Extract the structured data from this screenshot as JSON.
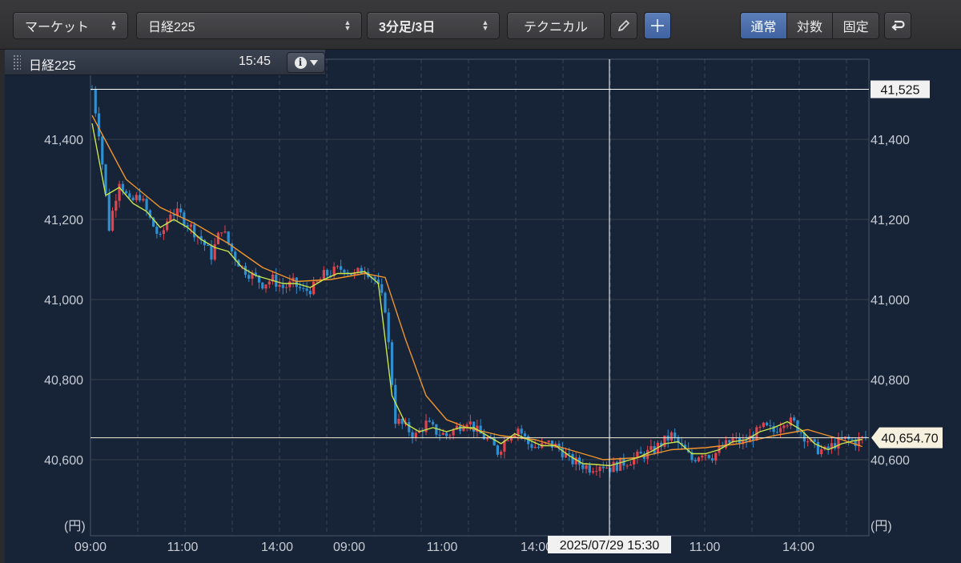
{
  "toolbar": {
    "market_select": "マーケット",
    "symbol_select": "日経225",
    "interval_select": "3分足/3日",
    "technical_button": "テクニカル",
    "scale_modes": [
      "通常",
      "対数",
      "固定"
    ],
    "active_scale_mode": "通常"
  },
  "chart_header": {
    "symbol": "日経225",
    "time": "15:45"
  },
  "colors": {
    "background": "#172336",
    "up_candle": "#e0454d",
    "down_candle": "#2f8fd0",
    "ma_short": "#c8e64a",
    "ma_long": "#f0942c",
    "accent": "#4a6fae"
  },
  "chart_data": {
    "type": "candlestick",
    "symbol": "日経225",
    "unit_label": "(円)",
    "y_range": [
      40410,
      41600
    ],
    "y_ticks": [
      "41,400",
      "41,200",
      "41,000",
      "40,800",
      "40,600"
    ],
    "x_ticks": [
      "09:00",
      "11:00",
      "14:00",
      "09:00",
      "11:00",
      "14:00",
      "11:00",
      "14:00"
    ],
    "grid": true,
    "high_line": {
      "value": 41525,
      "label": "41,525"
    },
    "last_price": {
      "value": 40654.7,
      "label": "40,654.70"
    },
    "crosshair_label": "2025/07/29 15:30",
    "price_path": [
      [
        0,
        41525
      ],
      [
        2,
        41420
      ],
      [
        5,
        41180
      ],
      [
        8,
        41300
      ],
      [
        11,
        41240
      ],
      [
        14,
        41260
      ],
      [
        17,
        41200
      ],
      [
        20,
        41150
      ],
      [
        23,
        41220
      ],
      [
        26,
        41210
      ],
      [
        29,
        41180
      ],
      [
        32,
        41150
      ],
      [
        35,
        41110
      ],
      [
        38,
        41180
      ],
      [
        41,
        41120
      ],
      [
        44,
        41080
      ],
      [
        47,
        41060
      ],
      [
        50,
        41040
      ],
      [
        53,
        41050
      ],
      [
        56,
        41030
      ],
      [
        59,
        41040
      ],
      [
        62,
        41020
      ],
      [
        65,
        41030
      ],
      [
        68,
        41060
      ],
      [
        71,
        41070
      ],
      [
        74,
        41080
      ],
      [
        77,
        41060
      ],
      [
        80,
        41080
      ],
      [
        83,
        41050
      ],
      [
        86,
        40980
      ],
      [
        89,
        40700
      ],
      [
        92,
        40680
      ],
      [
        95,
        40660
      ],
      [
        98,
        40690
      ],
      [
        101,
        40670
      ],
      [
        104,
        40660
      ],
      [
        107,
        40680
      ],
      [
        110,
        40700
      ],
      [
        113,
        40670
      ],
      [
        116,
        40650
      ],
      [
        119,
        40620
      ],
      [
        122,
        40660
      ],
      [
        125,
        40680
      ],
      [
        128,
        40640
      ],
      [
        131,
        40630
      ],
      [
        134,
        40640
      ],
      [
        137,
        40630
      ],
      [
        140,
        40600
      ],
      [
        143,
        40590
      ],
      [
        146,
        40580
      ],
      [
        149,
        40590
      ],
      [
        152,
        40580
      ],
      [
        155,
        40590
      ],
      [
        158,
        40600
      ],
      [
        161,
        40610
      ],
      [
        164,
        40620
      ],
      [
        167,
        40640
      ],
      [
        170,
        40660
      ],
      [
        173,
        40630
      ],
      [
        176,
        40600
      ],
      [
        179,
        40620
      ],
      [
        182,
        40610
      ],
      [
        185,
        40630
      ],
      [
        188,
        40650
      ],
      [
        191,
        40640
      ],
      [
        194,
        40660
      ],
      [
        197,
        40680
      ],
      [
        200,
        40670
      ],
      [
        203,
        40700
      ],
      [
        206,
        40690
      ],
      [
        209,
        40660
      ],
      [
        212,
        40630
      ],
      [
        215,
        40620
      ],
      [
        218,
        40640
      ],
      [
        221,
        40650
      ],
      [
        224,
        40645
      ],
      [
        227,
        40655
      ]
    ],
    "ma_short_path": [
      [
        0,
        41440
      ],
      [
        4,
        41260
      ],
      [
        8,
        41280
      ],
      [
        12,
        41240
      ],
      [
        16,
        41220
      ],
      [
        20,
        41180
      ],
      [
        24,
        41200
      ],
      [
        28,
        41180
      ],
      [
        32,
        41150
      ],
      [
        36,
        41130
      ],
      [
        40,
        41120
      ],
      [
        44,
        41080
      ],
      [
        48,
        41060
      ],
      [
        52,
        41050
      ],
      [
        56,
        41040
      ],
      [
        60,
        41040
      ],
      [
        64,
        41030
      ],
      [
        68,
        41050
      ],
      [
        72,
        41065
      ],
      [
        76,
        41065
      ],
      [
        80,
        41070
      ],
      [
        84,
        41040
      ],
      [
        88,
        40760
      ],
      [
        92,
        40690
      ],
      [
        96,
        40670
      ],
      [
        100,
        40680
      ],
      [
        104,
        40670
      ],
      [
        108,
        40680
      ],
      [
        112,
        40680
      ],
      [
        116,
        40660
      ],
      [
        120,
        40640
      ],
      [
        124,
        40665
      ],
      [
        128,
        40650
      ],
      [
        132,
        40635
      ],
      [
        136,
        40635
      ],
      [
        140,
        40610
      ],
      [
        144,
        40590
      ],
      [
        148,
        40588
      ],
      [
        152,
        40585
      ],
      [
        156,
        40595
      ],
      [
        160,
        40605
      ],
      [
        164,
        40620
      ],
      [
        168,
        40640
      ],
      [
        172,
        40645
      ],
      [
        176,
        40615
      ],
      [
        180,
        40615
      ],
      [
        184,
        40625
      ],
      [
        188,
        40645
      ],
      [
        192,
        40650
      ],
      [
        196,
        40670
      ],
      [
        200,
        40680
      ],
      [
        204,
        40695
      ],
      [
        208,
        40675
      ],
      [
        212,
        40640
      ],
      [
        216,
        40625
      ],
      [
        220,
        40640
      ],
      [
        224,
        40648
      ],
      [
        227,
        40652
      ]
    ],
    "ma_long_path": [
      [
        0,
        41460
      ],
      [
        10,
        41300
      ],
      [
        20,
        41230
      ],
      [
        30,
        41190
      ],
      [
        40,
        41140
      ],
      [
        50,
        41080
      ],
      [
        60,
        41045
      ],
      [
        70,
        41050
      ],
      [
        80,
        41065
      ],
      [
        86,
        41055
      ],
      [
        92,
        40900
      ],
      [
        98,
        40760
      ],
      [
        104,
        40700
      ],
      [
        110,
        40680
      ],
      [
        120,
        40660
      ],
      [
        130,
        40650
      ],
      [
        140,
        40625
      ],
      [
        150,
        40600
      ],
      [
        160,
        40605
      ],
      [
        170,
        40625
      ],
      [
        180,
        40630
      ],
      [
        190,
        40640
      ],
      [
        200,
        40660
      ],
      [
        210,
        40675
      ],
      [
        220,
        40650
      ],
      [
        227,
        40630
      ]
    ]
  }
}
